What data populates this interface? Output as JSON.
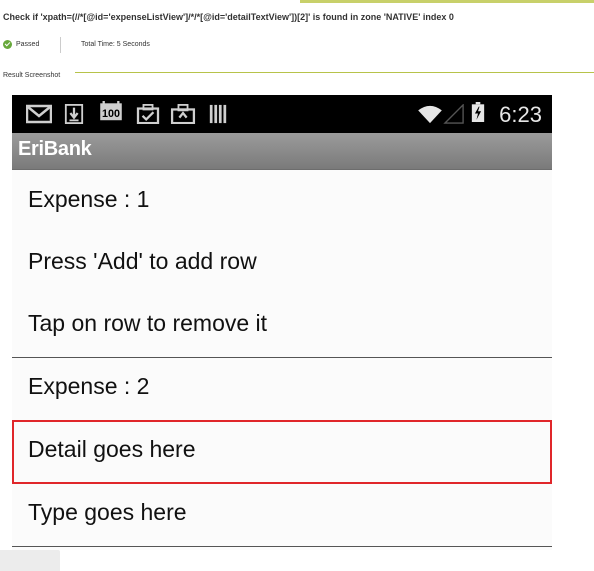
{
  "report": {
    "check_title": "Check if 'xpath=(//*[@id='expenseListView']/*/*[@id='detailTextView'])[2]' is found in zone 'NATIVE' index 0",
    "status": "Passed",
    "total_time": "Total Time: 5 Seconds",
    "result_label": "Result Screenshot",
    "status_color": "#67a83b"
  },
  "phone": {
    "status_bar": {
      "icons": [
        "gmail-icon",
        "download-icon",
        "calendar-100-icon",
        "clipboard-check-icon",
        "briefcase-upload-icon",
        "barcode-icon",
        "wifi-icon",
        "signal-icon",
        "battery-charging-icon"
      ],
      "calendar_badge": "100",
      "time": "6:23"
    },
    "app_title": "EriBank",
    "rows": [
      {
        "text": "Expense : 1"
      },
      {
        "text": "Press 'Add' to add row"
      },
      {
        "text": "Tap on row to remove it"
      },
      {
        "text": "Expense : 2"
      },
      {
        "text": "Detail goes here"
      },
      {
        "text": "Type goes here"
      }
    ],
    "highlight_color": "#e0262a"
  }
}
